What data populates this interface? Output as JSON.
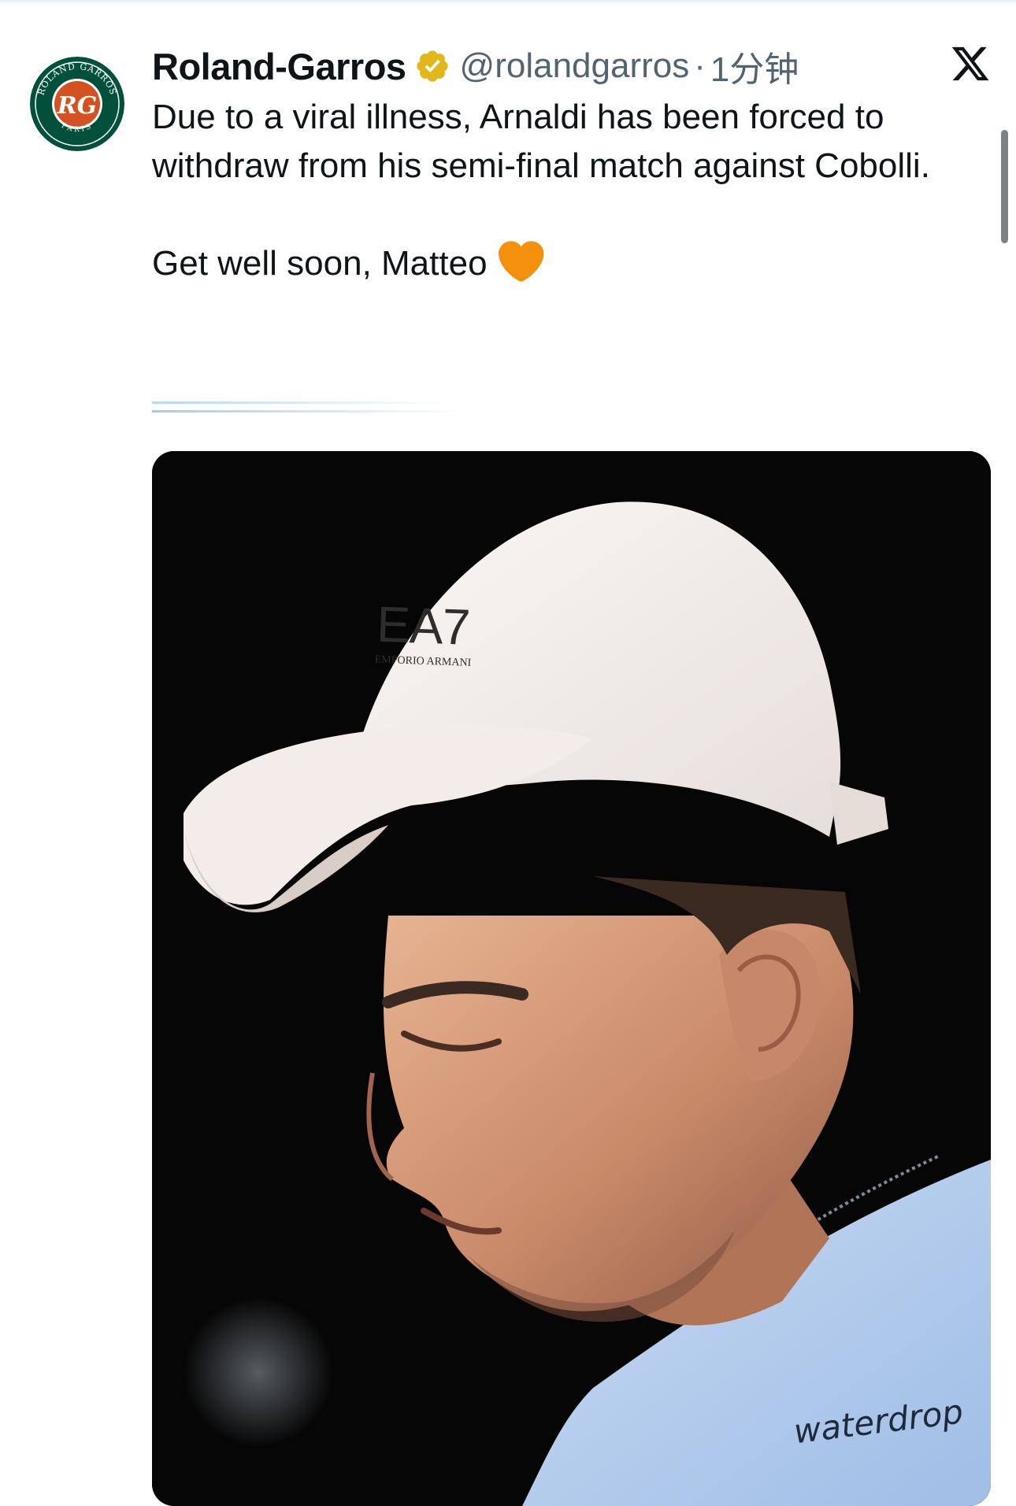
{
  "tweet": {
    "author_name": "Roland-Garros",
    "handle": "@rolandgarros",
    "separator": "·",
    "time": "1分钟",
    "text_paragraph_1": "Due to a viral illness, Arnaldi has been forced to withdraw from his semi-final match against Cobolli.",
    "text_paragraph_2": "Get well soon, Matteo",
    "emoji": "orange-heart"
  },
  "avatar": {
    "brand": "ROLAND GARROS",
    "sub": "PARIS",
    "colors": {
      "green": "#00503c",
      "clay": "#d35220"
    }
  },
  "media": {
    "cap_logo": "EA7",
    "cap_sub": "EMPORIO ARMANI",
    "shirt_sponsor": "waterdrop"
  },
  "colors": {
    "text": "#0f1419",
    "secondary_text": "#536471",
    "verified_gold": "#e2b719",
    "heart_orange": "#f4900c"
  }
}
